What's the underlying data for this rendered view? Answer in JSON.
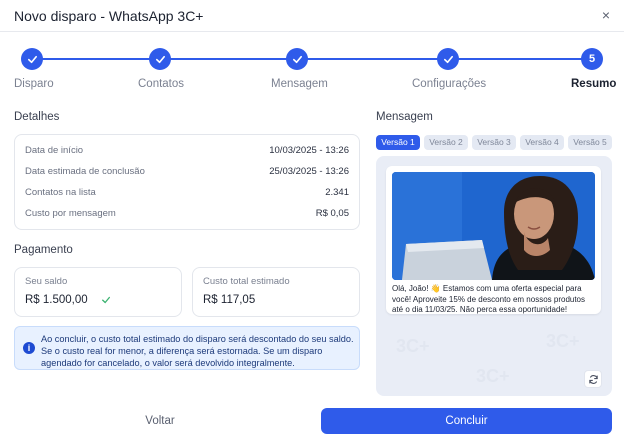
{
  "dialog": {
    "title": "Novo disparo - WhatsApp 3C+",
    "close_glyph": "×"
  },
  "stepper": {
    "steps": [
      {
        "label": "Disparo",
        "status": "done"
      },
      {
        "label": "Contatos",
        "status": "done"
      },
      {
        "label": "Mensagem",
        "status": "done"
      },
      {
        "label": "Configurações",
        "status": "done"
      },
      {
        "label": "Resumo",
        "status": "active",
        "number": "5"
      }
    ]
  },
  "details": {
    "title": "Detalhes",
    "rows": [
      {
        "label": "Data de início",
        "value": "10/03/2025 - 13:26"
      },
      {
        "label": "Data estimada de conclusão",
        "value": "25/03/2025 - 13:26"
      },
      {
        "label": "Contatos na lista",
        "value": "2.341"
      },
      {
        "label": "Custo por mensagem",
        "value": "R$ 0,05"
      }
    ]
  },
  "payment": {
    "title": "Pagamento",
    "balance_label": "Seu saldo",
    "balance_value": "R$ 1.500,00",
    "cost_label": "Custo total estimado",
    "cost_value": "R$ 117,05",
    "info": "Ao concluir, o custo total estimado do disparo será descontado do seu saldo. Se o custo real for menor, a diferença será estornada. Se um disparo agendado for cancelado, o valor será devolvido integralmente."
  },
  "message": {
    "title": "Mensagem",
    "versions": [
      "Versão 1",
      "Versão 2",
      "Versão 3",
      "Versão 4",
      "Versão 5"
    ],
    "active_version": "Versão 1",
    "text": "Olá, João! 👋 Estamos com uma oferta especial para você! Aproveite 15% de desconto em nossos produtos até o dia 11/03/25. Não perca essa oportunidade!"
  },
  "footer": {
    "back_label": "Voltar",
    "done_label": "Concluir"
  },
  "colors": {
    "accent": "#2f5bea",
    "success": "#3cb371",
    "info_bg": "#e8f1ff"
  },
  "icons": {
    "check": "check-icon",
    "close": "close-icon",
    "info": "info-icon",
    "refresh": "refresh-icon"
  }
}
